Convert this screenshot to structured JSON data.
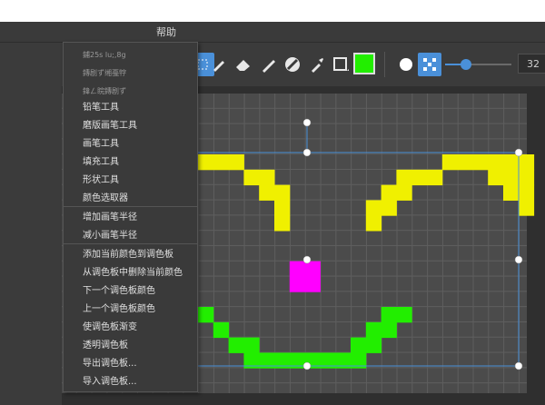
{
  "menubar": {
    "help_label": "帮助"
  },
  "toolbar": {
    "icons": [
      "selection-icon",
      "pencil-icon",
      "eraser-icon",
      "brush-icon",
      "fill-icon",
      "color-picker-icon",
      "shape-icon"
    ],
    "color": "#22ee00",
    "brush_size": "32",
    "brush_size_level": 0.32
  },
  "menu": {
    "items": [
      {
        "label": "鋪25s lu;,8g",
        "dim": true
      },
      {
        "label": "鏄剧ず缃戞牸",
        "dim": true
      },
      {
        "label": "鍏ㄥ睆鏄剧ず",
        "dim": true
      },
      {
        "label": "铅笔工具"
      },
      {
        "label": "磨版画笔工具"
      },
      {
        "label": "画笔工具"
      },
      {
        "label": "填充工具"
      },
      {
        "label": "形状工具"
      },
      {
        "label": "颜色选取器"
      },
      {
        "label": "增加画笔半径"
      },
      {
        "label": "减小画笔半径"
      },
      {
        "label": "添加当前颜色到调色板"
      },
      {
        "label": "从调色板中删除当前颜色"
      },
      {
        "label": "下一个调色板颜色"
      },
      {
        "label": "上一个调色板颜色"
      },
      {
        "label": "使调色板渐变"
      },
      {
        "label": "透明调色板"
      },
      {
        "label": "导出调色板..."
      },
      {
        "label": "导入调色板..."
      }
    ]
  },
  "colors": {
    "eyes": "#f0f000",
    "nose": "#ff00ff",
    "mouth": "#22ee00",
    "selection": "#4a90d9"
  }
}
